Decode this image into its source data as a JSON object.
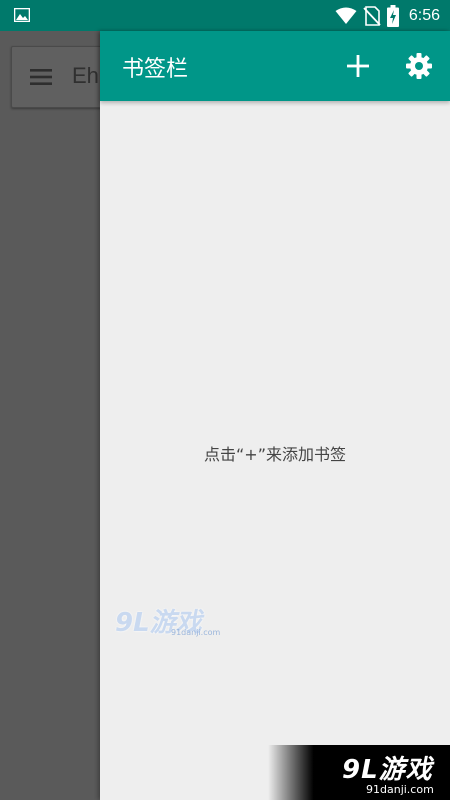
{
  "status_bar": {
    "time": "6:56",
    "icons": [
      "gallery-icon",
      "wifi-icon",
      "no-sim-icon",
      "battery-charging-icon"
    ]
  },
  "background_app": {
    "title": "Eh",
    "menu_icon": "menu-icon"
  },
  "drawer": {
    "title": "书签栏",
    "add_icon": "plus-icon",
    "settings_icon": "gear-icon",
    "empty_hint": "点击“+”来添加书签"
  },
  "watermarks": {
    "mid_logo": "9L游戏",
    "mid_url": "91danji.com",
    "corner_logo": "9L游戏",
    "corner_url": "91danji.com"
  },
  "colors": {
    "status_bar": "#00796b",
    "header": "#009688",
    "drawer_bg": "#eeeeee",
    "scrim": "#5c5c5c"
  }
}
